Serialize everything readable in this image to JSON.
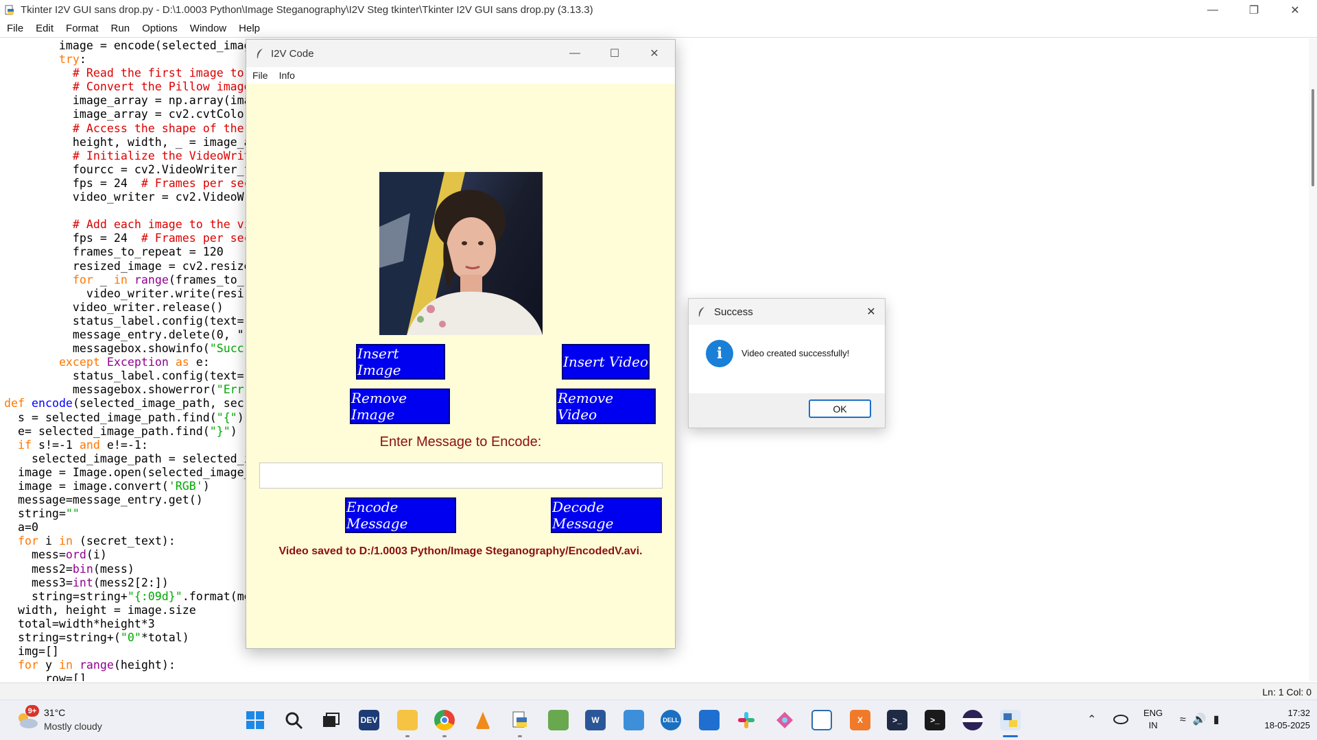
{
  "idle": {
    "title": "Tkinter I2V GUI sans drop.py - D:\\1.0003 Python\\Image Steganography\\I2V Steg tkinter\\Tkinter I2V GUI sans drop.py (3.13.3)",
    "menu": [
      "File",
      "Edit",
      "Format",
      "Run",
      "Options",
      "Window",
      "Help"
    ],
    "status_position": "Ln: 1   Col: 0"
  },
  "app": {
    "title": "I2V Code",
    "menu": [
      "File",
      "Info"
    ],
    "buttons": {
      "insert_image": "Insert Image",
      "insert_video": "Insert Video",
      "remove_image": "Remove Image",
      "remove_video": "Remove Video",
      "encode_message": "Encode Message",
      "decode_message": "Decode Message"
    },
    "prompt_label": "Enter Message to Encode:",
    "message_entry_value": "",
    "status_label": "Video saved to D:/1.0003 Python/Image  Steganography/EncodedV.avi."
  },
  "dialog": {
    "title": "Success",
    "message": "Video created successfully!",
    "ok_label": "OK",
    "icon": "info-icon"
  },
  "taskbar": {
    "weather_badge": "9+",
    "weather_temp": "31°C",
    "weather_desc": "Mostly cloudy",
    "lang_line1": "ENG",
    "lang_line2": "IN",
    "time": "17:32",
    "date": "18-05-2025",
    "apps": [
      "windows-start",
      "search",
      "task-view",
      "dev-home",
      "file-explorer",
      "chrome",
      "vlc",
      "python-idle",
      "image-viewer",
      "word",
      "notepad",
      "dell",
      "store",
      "slack",
      "git",
      "window-app",
      "xampp",
      "powershell",
      "terminal",
      "eclipse",
      "python-app"
    ]
  }
}
